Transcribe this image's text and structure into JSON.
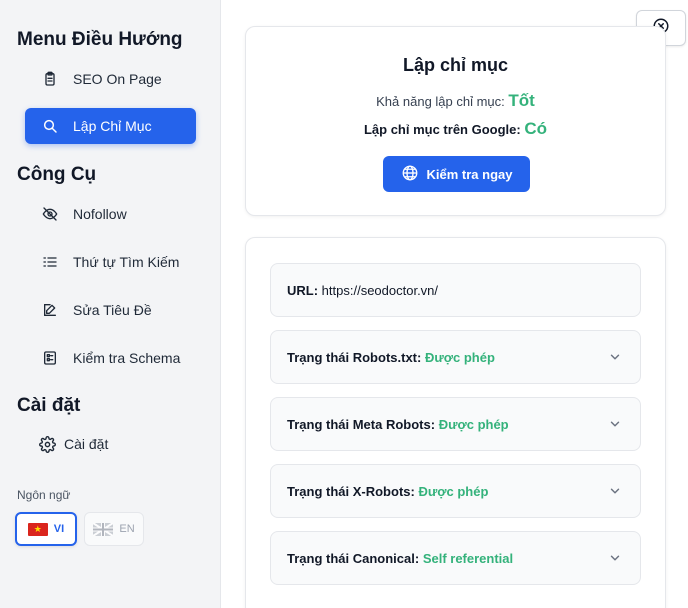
{
  "sidebar": {
    "nav_title": "Menu Điều Hướng",
    "nav_items": [
      {
        "label": "SEO On Page",
        "icon": "clipboard-icon"
      },
      {
        "label": "Lập Chỉ Mục",
        "icon": "search-icon",
        "active": true
      }
    ],
    "tools_title": "Công Cụ",
    "tool_items": [
      {
        "label": "Nofollow",
        "icon": "eye-off-icon"
      },
      {
        "label": "Thứ tự Tìm Kiếm",
        "icon": "list-ordered-icon"
      },
      {
        "label": "Sửa Tiêu Đề",
        "icon": "edit-icon"
      },
      {
        "label": "Kiểm tra Schema",
        "icon": "schema-icon"
      }
    ],
    "settings_title": "Cài đặt",
    "settings_item": {
      "label": "Cài đặt",
      "icon": "gear-icon"
    },
    "language_label": "Ngôn ngữ",
    "languages": [
      {
        "code": "VI",
        "selected": true
      },
      {
        "code": "EN",
        "selected": false
      }
    ]
  },
  "index_card": {
    "title": "Lập chỉ mục",
    "indexability_label": "Khả năng lập chỉ mục:",
    "indexability_value": "Tốt",
    "google_label": "Lập chỉ mục trên Google:",
    "google_value": "Có",
    "check_button": "Kiểm tra ngay"
  },
  "details": {
    "url_label": "URL:",
    "url_value": "https://seodoctor.vn/",
    "rows": [
      {
        "label": "Trạng thái Robots.txt:",
        "value": "Được phép"
      },
      {
        "label": "Trạng thái Meta Robots:",
        "value": "Được phép"
      },
      {
        "label": "Trạng thái X-Robots:",
        "value": "Được phép"
      },
      {
        "label": "Trạng thái Canonical:",
        "value": "Self referential"
      }
    ]
  },
  "colors": {
    "accent": "#2563eb",
    "success": "#34b27b"
  }
}
